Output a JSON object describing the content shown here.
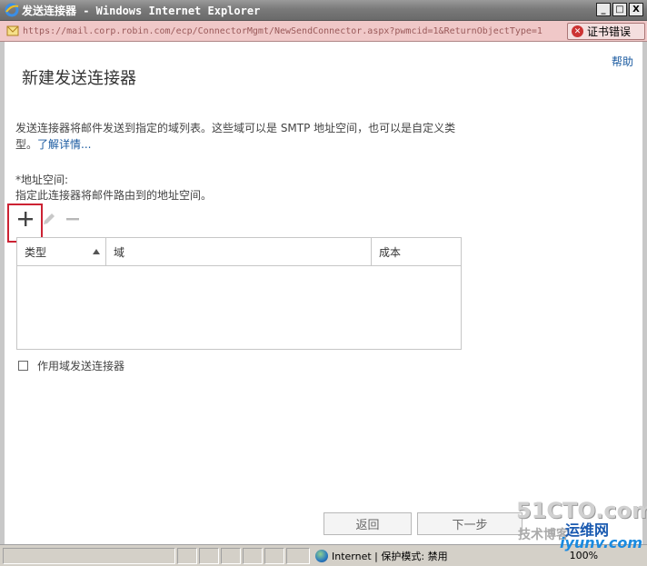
{
  "window": {
    "title": "发送连接器 - Windows Internet Explorer",
    "minimize": "_",
    "maximize": "□",
    "close": "X"
  },
  "addressbar": {
    "url": "https://mail.corp.robin.com/ecp/ConnectorMgmt/NewSendConnector.aspx?pwmcid=1&ReturnObjectType=1",
    "cert_error": "证书错误"
  },
  "page": {
    "help": "帮助",
    "title": "新建发送连接器",
    "intro_text": "发送连接器将邮件发送到指定的域列表。这些域可以是 SMTP 地址空间，也可以是自定义类型。",
    "intro_link": "了解详情...",
    "address_space_label": "*地址空间:",
    "address_space_desc": "指定此连接器将邮件路由到的地址空间。"
  },
  "toolbar": {
    "add_icon": "plus-icon",
    "edit_icon": "pencil-icon",
    "remove_icon": "minus-icon"
  },
  "grid": {
    "columns": [
      "类型",
      "域",
      "成本"
    ],
    "sort_column": "类型",
    "sort_direction": "ascending",
    "rows": []
  },
  "scoped_checkbox": {
    "label": "作用域发送连接器",
    "checked": false
  },
  "buttons": {
    "back": "返回",
    "next": "下一步"
  },
  "statusbar": {
    "zone": "Internet | 保护模式: 禁用",
    "zoom": "100%"
  },
  "watermark": {
    "line1": "51CTO.com",
    "line2": "技术博客",
    "line3": "运维网",
    "line4": "iyunv.com"
  },
  "colors": {
    "highlight_box": "#cc2233",
    "link": "#1a5aa0",
    "addressbar_error": "#f0c8c8"
  }
}
